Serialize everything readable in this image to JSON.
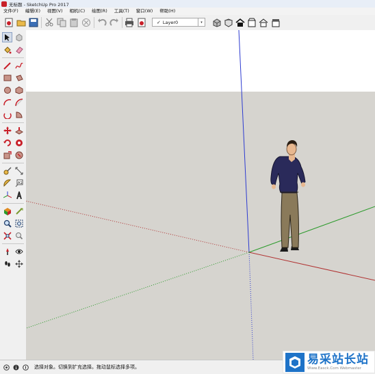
{
  "window": {
    "title": "无标题 - SketchUp Pro 2017"
  },
  "menu": [
    "文件(F)",
    "编辑(E)",
    "视图(V)",
    "相机(C)",
    "绘图(R)",
    "工具(T)",
    "窗口(W)",
    "帮助(H)"
  ],
  "layer": {
    "check": "✓",
    "name": "Layer0",
    "arrow": "▾"
  },
  "status": {
    "message": "选择对象。切换到扩充选择。拖动鼠标选择多项。"
  },
  "watermark": {
    "title": "易采站长站",
    "url": "Www.Easck.Com  Webmaster"
  },
  "colors": {
    "sky": "#ffffff",
    "ground": "#d6d4cf",
    "axis_red": "#b03030",
    "axis_green": "#2a9a2a",
    "axis_blue": "#2c3ad0"
  }
}
